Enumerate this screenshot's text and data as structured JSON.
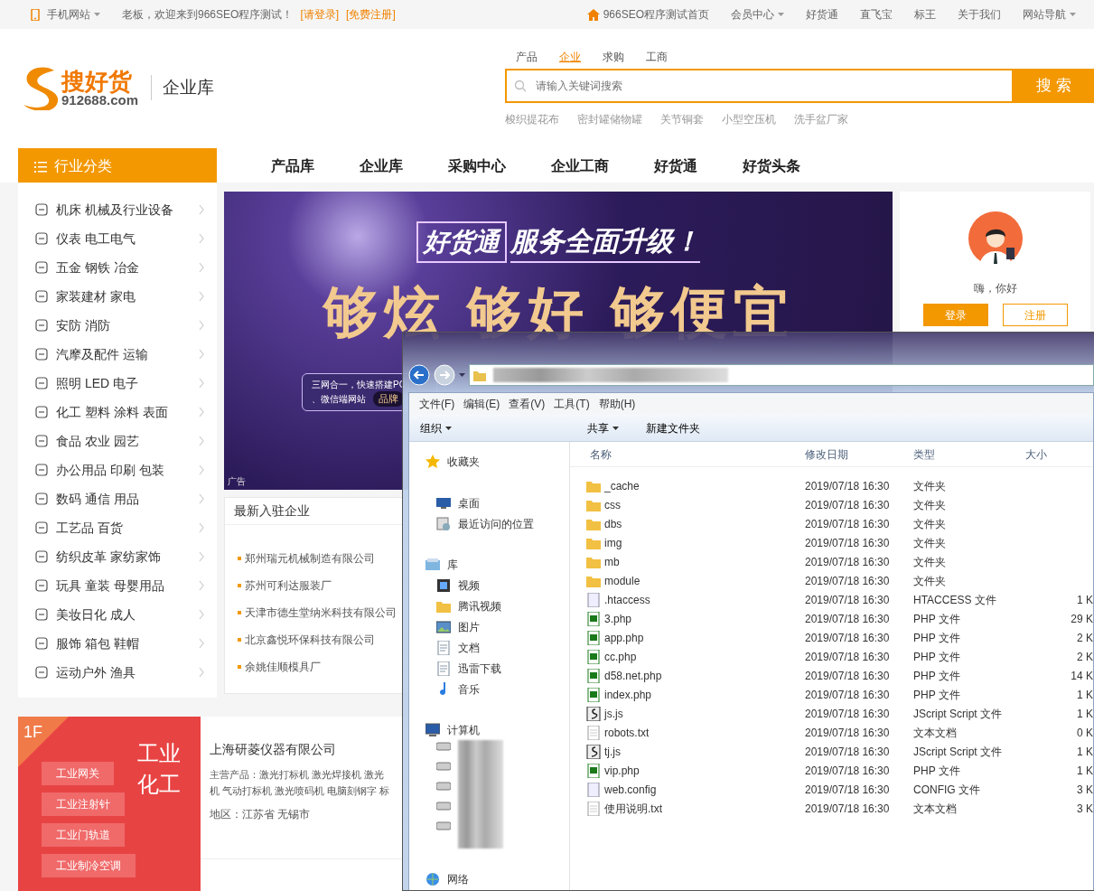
{
  "top_bar": {
    "mobile_site": "手机网站",
    "welcome": "老板，欢迎来到966SEO程序测试！",
    "login": "[请登录]",
    "register": "[免费注册]",
    "links": [
      {
        "label": "966SEO程序测试首页",
        "kind": "home"
      },
      {
        "label": "会员中心",
        "kind": "dropdown"
      },
      {
        "label": "好货通",
        "kind": "plain"
      },
      {
        "label": "直飞宝",
        "kind": "plain"
      },
      {
        "label": "标王",
        "kind": "plain"
      },
      {
        "label": "关于我们",
        "kind": "plain"
      },
      {
        "label": "网站导航",
        "kind": "dropdown"
      }
    ]
  },
  "header": {
    "logo_name": "搜好货",
    "logo_domain": "912688.com",
    "section": "企业库",
    "search_tabs": [
      {
        "label": "产品",
        "selected": false
      },
      {
        "label": "企业",
        "selected": true
      },
      {
        "label": "求购",
        "selected": false
      },
      {
        "label": "工商",
        "selected": false
      }
    ],
    "search": {
      "placeholder": "请输入关键词搜索",
      "button": "搜 索"
    },
    "hot_keywords": [
      "梭织提花布",
      "密封罐储物罐",
      "关节铜套",
      "小型空压机",
      "洗手盆厂家"
    ]
  },
  "nav": {
    "category_title": "行业分类",
    "links": [
      "产品库",
      "企业库",
      "采购中心",
      "企业工商",
      "好货通",
      "好货头条"
    ]
  },
  "categories": [
    "机床 机械及行业设备",
    "仪表 电工电气",
    "五金 钢铁 冶金",
    "家装建材 家电",
    "安防 消防",
    "汽摩及配件 运输",
    "照明 LED 电子",
    "化工 塑料 涂料 表面",
    "食品 农业 园艺",
    "办公用品 印刷 包装",
    "数码 通信 用品",
    "工艺品 百货",
    "纺织皮革 家纺家饰",
    "玩具 童装 母婴用品",
    "美妆日化 成人",
    "服饰 箱包 鞋帽",
    "运动户外 渔具"
  ],
  "banner": {
    "tag": "好货通",
    "headline": "服务全面升级！",
    "slogan": "够炫 够好 够便宜",
    "note_lines": [
      "三网合一，快速搭建PC",
      "、微信端网站"
    ],
    "note_badge": "品牌",
    "ad_label": "广告"
  },
  "user_box": {
    "greeting": "嗨，你好",
    "login": "登录",
    "register": "注册"
  },
  "latest": {
    "title": "最新入驻企业",
    "companies": [
      "郑州瑞元机械制造有限公司",
      "苏州可利达服装厂",
      "天津市德生堂纳米科技有限公司",
      "北京鑫悦环保科技有限公司",
      "余姚佳顺模具厂"
    ]
  },
  "floor": {
    "number": "1F",
    "title_lines": [
      "工业",
      "化工"
    ],
    "tags": [
      "工业网关",
      "工业注射针",
      "工业门轨道",
      "工业制冷空调"
    ],
    "company": {
      "name": "上海研菱仪器有限公司",
      "product_lines": [
        "主营产品：激光打标机 激光焊接机 激光",
        "机 气动打标机 激光喷码机 电脑刻钢字 标"
      ],
      "region": "地区：江苏省 无锡市"
    }
  },
  "explorer": {
    "menu": [
      "文件(F)",
      "编辑(E)",
      "查看(V)",
      "工具(T)",
      "帮助(H)"
    ],
    "toolbar": [
      {
        "label": "组织",
        "dropdown": true
      },
      {
        "label": "共享",
        "dropdown": true
      },
      {
        "label": "新建文件夹",
        "dropdown": false
      }
    ],
    "nav_groups": [
      {
        "label": "收藏夹",
        "kind": "star",
        "children": [
          {
            "label": "桌面",
            "kind": "desktop"
          },
          {
            "label": "最近访问的位置",
            "kind": "recent"
          }
        ]
      },
      {
        "label": "库",
        "kind": "library",
        "children": [
          {
            "label": "视频",
            "kind": "video"
          },
          {
            "label": "腾讯视频",
            "kind": "folder"
          },
          {
            "label": "图片",
            "kind": "picture"
          },
          {
            "label": "文档",
            "kind": "doc"
          },
          {
            "label": "迅雷下载",
            "kind": "doc"
          },
          {
            "label": "音乐",
            "kind": "music"
          }
        ]
      },
      {
        "label": "计算机",
        "kind": "computer"
      },
      {
        "label": "网络",
        "kind": "network"
      }
    ],
    "columns": [
      "名称",
      "修改日期",
      "类型",
      "大小"
    ],
    "files": [
      {
        "name": "_cache",
        "date": "2019/07/18 16:30",
        "type": "文件夹",
        "kind": "folder"
      },
      {
        "name": "css",
        "date": "2019/07/18 16:30",
        "type": "文件夹",
        "kind": "folder"
      },
      {
        "name": "dbs",
        "date": "2019/07/18 16:30",
        "type": "文件夹",
        "kind": "folder"
      },
      {
        "name": "img",
        "date": "2019/07/18 16:30",
        "type": "文件夹",
        "kind": "folder"
      },
      {
        "name": "mb",
        "date": "2019/07/18 16:30",
        "type": "文件夹",
        "kind": "folder"
      },
      {
        "name": "module",
        "date": "2019/07/18 16:30",
        "type": "文件夹",
        "kind": "folder"
      },
      {
        "name": ".htaccess",
        "date": "2019/07/18 16:30",
        "type": "HTACCESS 文件",
        "size": "1 K",
        "kind": "file"
      },
      {
        "name": "3.php",
        "date": "2019/07/18 16:30",
        "type": "PHP 文件",
        "size": "29 K",
        "kind": "php"
      },
      {
        "name": "app.php",
        "date": "2019/07/18 16:30",
        "type": "PHP 文件",
        "size": "2 K",
        "kind": "php"
      },
      {
        "name": "cc.php",
        "date": "2019/07/18 16:30",
        "type": "PHP 文件",
        "size": "2 K",
        "kind": "php"
      },
      {
        "name": "d58.net.php",
        "date": "2019/07/18 16:30",
        "type": "PHP 文件",
        "size": "14 K",
        "kind": "php"
      },
      {
        "name": "index.php",
        "date": "2019/07/18 16:30",
        "type": "PHP 文件",
        "size": "1 K",
        "kind": "php"
      },
      {
        "name": "js.js",
        "date": "2019/07/18 16:30",
        "type": "JScript Script 文件",
        "size": "1 K",
        "kind": "script"
      },
      {
        "name": "robots.txt",
        "date": "2019/07/18 16:30",
        "type": "文本文档",
        "size": "0 K",
        "kind": "text"
      },
      {
        "name": "tj.js",
        "date": "2019/07/18 16:30",
        "type": "JScript Script 文件",
        "size": "1 K",
        "kind": "script"
      },
      {
        "name": "vip.php",
        "date": "2019/07/18 16:30",
        "type": "PHP 文件",
        "size": "1 K",
        "kind": "php"
      },
      {
        "name": "web.config",
        "date": "2019/07/18 16:30",
        "type": "CONFIG 文件",
        "size": "3 K",
        "kind": "file"
      },
      {
        "name": "使用说明.txt",
        "date": "2019/07/18 16:30",
        "type": "文本文档",
        "size": "3 K",
        "kind": "text"
      }
    ]
  }
}
